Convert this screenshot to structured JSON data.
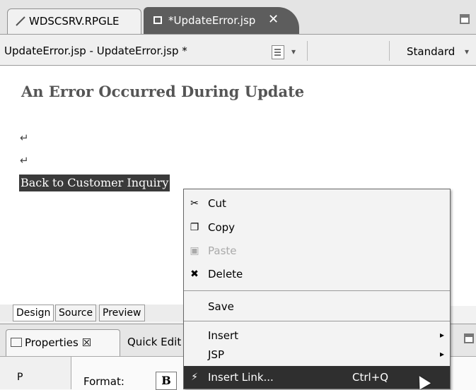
{
  "tabs": [
    {
      "label": "WDSCSRV.RPGLE"
    },
    {
      "label": "*UpdateError.jsp",
      "close": "✕"
    }
  ],
  "toolbar": {
    "title": "UpdateError.jsp - UpdateError.jsp *",
    "page_arrow": "▾",
    "mode": "Standard",
    "mode_arrow": "▾"
  },
  "canvas": {
    "heading": "An Error Occurred During Update",
    "return_marks": [
      "↵",
      "↵"
    ],
    "link_text": "Back to Customer Inquiry"
  },
  "bottom_tabs": [
    "Design",
    "Source",
    "Preview"
  ],
  "properties": {
    "tab_label": "Properties ☒",
    "quick_edit": "Quick Edit",
    "left_label": "P",
    "format_label": "Format:",
    "bold_button": "B"
  },
  "context_menu": {
    "items": [
      {
        "label": "Cut",
        "icon": "scissors-icon",
        "glyph": "✂"
      },
      {
        "label": "Copy",
        "icon": "copy-icon",
        "glyph": "❐"
      },
      {
        "label": "Paste",
        "icon": "paste-icon",
        "glyph": "▣",
        "disabled": true
      },
      {
        "label": "Delete",
        "icon": "delete-icon",
        "glyph": "✖"
      },
      {
        "label": "Save"
      },
      {
        "label": "Insert",
        "submenu": "▸"
      },
      {
        "label": "JSP",
        "submenu": "▸"
      },
      {
        "label": "Insert Link...",
        "icon": "link-icon",
        "glyph": "⚡",
        "accelerator": "Ctrl+Q",
        "highlighted": true
      }
    ]
  },
  "colors": {
    "highlight": "#2f2f2f",
    "active_tab": "#5d5d5d",
    "heading": "#555555"
  }
}
